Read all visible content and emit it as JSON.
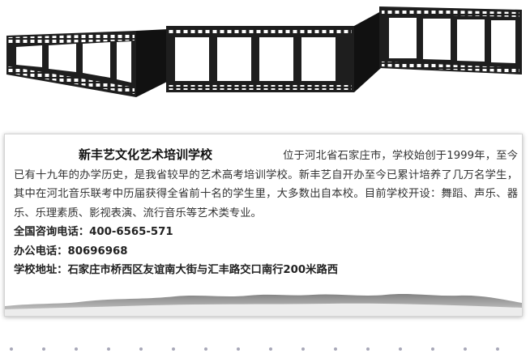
{
  "school": {
    "name": "新丰艺文化艺术培训学校",
    "intro": "位于河北省石家庄市，学校始创于1999年，至今已有十九年的办学历史，是我省较早的艺术高考培训学校。新丰艺自开办至今已累计培养了几万名学生，其中在河北音乐联考中历届获得全省前十名的学生里，大多数出自本校。目前学校开设：舞蹈、声乐、器乐、乐理素质、影视表演、流行音乐等艺术类专业。",
    "hotline": "全国咨询电话：400-6565-571",
    "office_phone": "办公电话：80696968",
    "address": "学校地址：石家庄市桥西区友谊南大街与汇丰路交口南行200米路西"
  },
  "colors": {
    "film": "#1e1e1e",
    "card_border": "#d4d4d4",
    "mountain": "#8a8a8a",
    "dot": "#a8a8b8"
  },
  "icons": {
    "banner": "filmstrip-icon",
    "footer_art": "mountain-icon"
  }
}
